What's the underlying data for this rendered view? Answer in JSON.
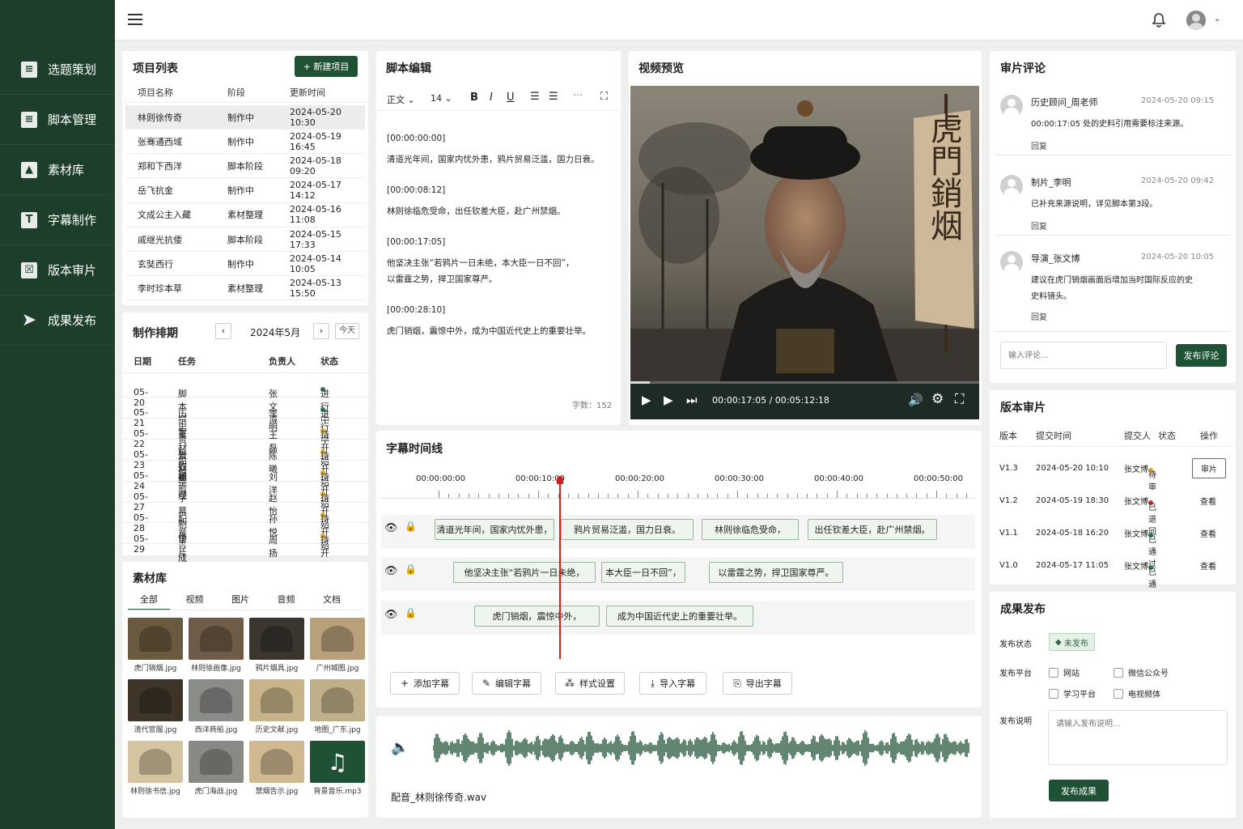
{
  "sidebar": {
    "items": [
      {
        "label": "选题策划",
        "icon": "document-icon"
      },
      {
        "label": "脚本管理",
        "icon": "script-icon"
      },
      {
        "label": "素材库",
        "icon": "image-folder-icon"
      },
      {
        "label": "字幕制作",
        "icon": "text-icon"
      },
      {
        "label": "版本审片",
        "icon": "review-icon"
      },
      {
        "label": "成果发布",
        "icon": "send-icon"
      }
    ]
  },
  "projects": {
    "title": "项目列表",
    "new_btn": "+ 新建项目",
    "headers": [
      "项目名称",
      "阶段",
      "更新时间"
    ],
    "rows": [
      [
        "林则徐传奇",
        "制作中",
        "2024-05-20 10:30"
      ],
      [
        "张骞通西域",
        "制作中",
        "2024-05-19 16:45"
      ],
      [
        "郑和下西洋",
        "脚本阶段",
        "2024-05-18 09:20"
      ],
      [
        "岳飞抗金",
        "制作中",
        "2024-05-17 14:12"
      ],
      [
        "文成公主入藏",
        "素材整理",
        "2024-05-16 11:08"
      ],
      [
        "戚继光抗倭",
        "脚本阶段",
        "2024-05-15 17:33"
      ],
      [
        "玄奘西行",
        "制作中",
        "2024-05-14 10:05"
      ],
      [
        "李时珍本草",
        "素材整理",
        "2024-05-13 15:50"
      ]
    ]
  },
  "schedule": {
    "title": "制作排期",
    "month": "2024年5月",
    "today": "今天",
    "headers": [
      "日期",
      "任务",
      "负责人",
      "状态"
    ],
    "rows": [
      [
        "05-20",
        "脚本撰写",
        "张文博",
        "进行中"
      ],
      [
        "05-21",
        "历史资料收集",
        "李明",
        "进行中"
      ],
      [
        "05-22",
        "素材拍摄",
        "王磊",
        "待开始"
      ],
      [
        "05-23",
        "素材整理",
        "陈曦",
        "待开始"
      ],
      [
        "05-24",
        "初剪",
        "刘洋",
        "待开始"
      ],
      [
        "05-27",
        "字幕制作",
        "赵怡",
        "待开始"
      ],
      [
        "05-28",
        "配音合成",
        "孙悦",
        "待开始"
      ],
      [
        "05-29",
        "审片评估",
        "周扬",
        "待开始"
      ]
    ],
    "colors": {
      "进行中": "#2e7d4f",
      "待开始": "#e0a020"
    }
  },
  "assets": {
    "title": "素材库",
    "tabs": [
      "全部",
      "视频",
      "图片",
      "音频",
      "文档"
    ],
    "items": [
      "虎门销烟.jpg",
      "林则徐画像.jpg",
      "鸦片烟具.jpg",
      "广州城图.jpg",
      "清代官服.jpg",
      "西洋商船.jpg",
      "历史文献.jpg",
      "地图_广东.jpg",
      "林则徐书信.jpg",
      "虎门海战.jpg",
      "禁烟告示.jpg",
      "背景音乐.mp3"
    ]
  },
  "script": {
    "title": "脚本编辑",
    "style": "正文",
    "size": "14",
    "word_count": "字数：152",
    "blocks": [
      [
        "[00:00:00:00]",
        "清道光年间，国家内忧外患，鸦片贸易泛滥，国力日衰。"
      ],
      [
        "[00:00:08:12]",
        "林则徐临危受命，出任钦差大臣，赴广州禁烟。"
      ],
      [
        "[00:00:17:05]",
        "他坚决主张“若鸦片一日未绝，本大臣一日不回”，",
        "以雷霆之势，捍卫国家尊严。"
      ],
      [
        "[00:00:28:10]",
        "虎门销烟，震惊中外，成为中国近代史上的重要壮举。"
      ]
    ]
  },
  "video": {
    "title": "视频预览",
    "time": "00:00:17:05 / 00:05:12:18",
    "banner": "虎門銷烟",
    "progress": 0.055
  },
  "timeline": {
    "title": "字幕时间线",
    "ticks": [
      "00:00:00:00",
      "00:00:10:00",
      "00:00:20:00",
      "00:00:30:00",
      "00:00:40:00",
      "00:00:50:00"
    ],
    "track1": [
      "清道光年间，国家内忧外患，",
      "鸦片贸易泛滥，国力日衰。",
      "林则徐临危受命，",
      "出任钦差大臣，赴广州禁烟。"
    ],
    "track2": [
      "他坚决主张“若鸦片一日未绝，",
      "本大臣一日不回”，",
      "以雷霆之势，捍卫国家尊严。"
    ],
    "track3": [
      "虎门销烟，震惊中外，",
      "成为中国近代史上的重要壮举。"
    ],
    "buttons": [
      "添加字幕",
      "编辑字幕",
      "样式设置",
      "导入字幕",
      "导出字幕"
    ],
    "audio_file": "配音_林则徐传奇.wav"
  },
  "comments": {
    "title": "审片评论",
    "placeholder": "输入评论...",
    "submit": "发布评论",
    "reply": "回复",
    "items": [
      {
        "user": "历史顾问_周老师",
        "time": "2024-05-20 09:15",
        "text": "00:00:17:05 处的史料引用需要标注来源。"
      },
      {
        "user": "制片_李明",
        "time": "2024-05-20 09:42",
        "text": "已补充来源说明，详见脚本第3段。"
      },
      {
        "user": "导演_张文博",
        "time": "2024-05-20 10:05",
        "text": "建议在虎门销烟画面后增加当时国际反应的史",
        "text2": "史料镜头。"
      }
    ]
  },
  "versions": {
    "title": "版本审片",
    "headers": [
      "版本",
      "提交时间",
      "提交人",
      "状态",
      "操作"
    ],
    "rows": [
      [
        "V1.3",
        "2024-05-20 10:10",
        "张文博",
        "待审",
        "审片"
      ],
      [
        "V1.2",
        "2024-05-19 18:30",
        "张文博",
        "已退回",
        "查看"
      ],
      [
        "V1.1",
        "2024-05-18 16:20",
        "张文博",
        "已通过",
        "查看"
      ],
      [
        "V1.0",
        "2024-05-17 11:05",
        "张文博",
        "已通过",
        "查看"
      ]
    ],
    "colors": {
      "待审": "#e0a020",
      "已退回": "#d03030",
      "已通过": "#2e7d4f"
    }
  },
  "publish": {
    "title": "成果发布",
    "status_label": "发布状态",
    "status": "未发布",
    "platform_label": "发布平台",
    "platforms": [
      "网站",
      "微信公众号",
      "学习平台",
      "电视频体"
    ],
    "desc_label": "发布说明",
    "desc_placeholder": "请输入发布说明...",
    "submit": "发布成果"
  }
}
